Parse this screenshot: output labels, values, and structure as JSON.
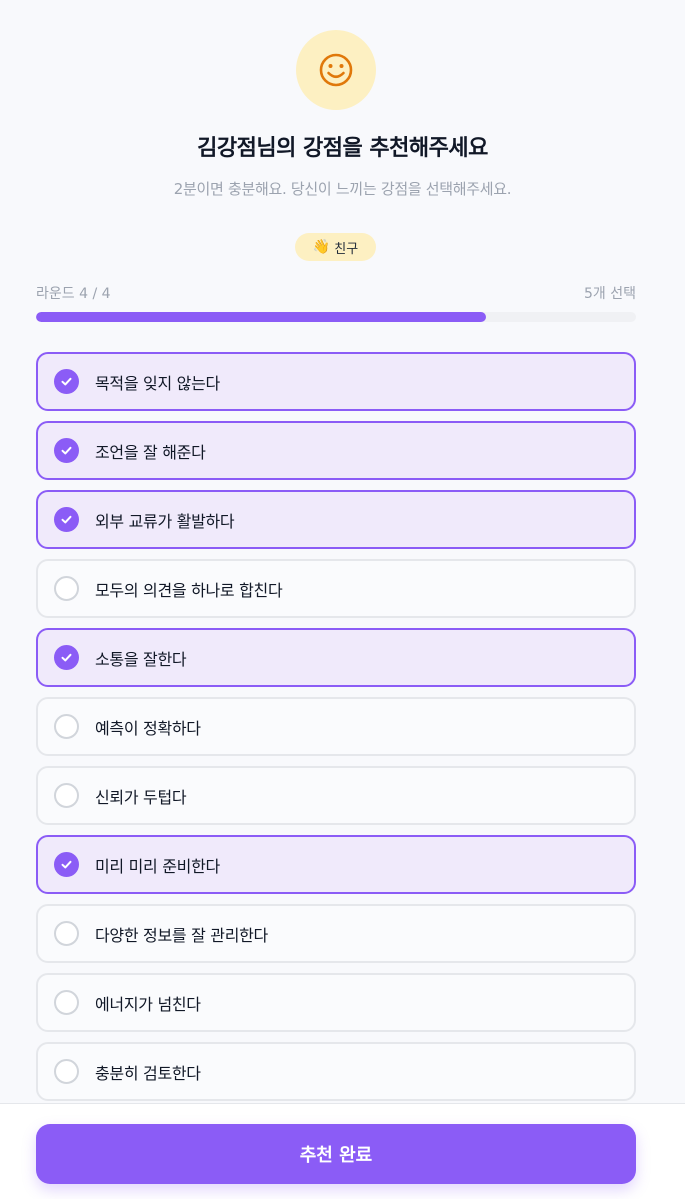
{
  "header": {
    "avatar_icon": "smiley-face-icon",
    "title": "김강점님의 강점을 추천해주세요",
    "subtitle": "2분이면 충분해요. 당신이 느끼는 강점을 선택해주세요."
  },
  "relation_badge": {
    "icon": "waving-hand-icon",
    "label": "친구"
  },
  "progress": {
    "round_label": "라운드 4 / 4",
    "selected_label": "5개 선택",
    "fill_fraction": 0.75
  },
  "options": [
    {
      "label": "목적을 잊지 않는다",
      "selected": true
    },
    {
      "label": "조언을 잘 해준다",
      "selected": true
    },
    {
      "label": "외부 교류가 활발하다",
      "selected": true
    },
    {
      "label": "모두의 의견을 하나로 합친다",
      "selected": false
    },
    {
      "label": "소통을 잘한다",
      "selected": true
    },
    {
      "label": "예측이 정확하다",
      "selected": false
    },
    {
      "label": "신뢰가 두텁다",
      "selected": false
    },
    {
      "label": "미리 미리 준비한다",
      "selected": true
    },
    {
      "label": "다양한 정보를 잘 관리한다",
      "selected": false
    },
    {
      "label": "에너지가 넘친다",
      "selected": false
    },
    {
      "label": "충분히 검토한다",
      "selected": false
    }
  ],
  "footer": {
    "submit_label": "추천 완료"
  },
  "colors": {
    "accent": "#8b5cf6",
    "selected_bg": "#f0eafb",
    "badge_bg": "#fdf0c2"
  }
}
